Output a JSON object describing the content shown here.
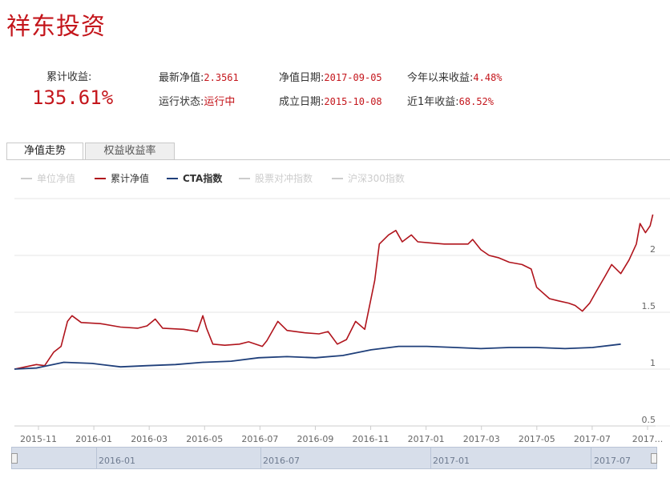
{
  "header": {
    "title": "祥东投资"
  },
  "stats": {
    "cumulative_label": "累计收益:",
    "cumulative_value": "135.61%",
    "latest_nav_label": "最新净值:",
    "latest_nav_value": "2.3561",
    "nav_date_label": "净值日期:",
    "nav_date_value": "2017-09-05",
    "ytd_label": "今年以来收益:",
    "ytd_value": "4.48%",
    "status_label": "运行状态:",
    "status_value": "运行中",
    "inception_label": "成立日期:",
    "inception_value": "2015-10-08",
    "one_year_label": "近1年收益:",
    "one_year_value": "68.52%"
  },
  "tabs": [
    "净值走势",
    "权益收益率"
  ],
  "legend": [
    {
      "label": "单位净值",
      "enabled": false
    },
    {
      "label": "累计净值",
      "enabled": true
    },
    {
      "label": "CTA指数",
      "enabled": true
    },
    {
      "label": "股票对冲指数",
      "enabled": false
    },
    {
      "label": "沪深300指数",
      "enabled": false
    }
  ],
  "navigator": {
    "labels": [
      "2016-01",
      "2016-07",
      "2017-01",
      "2017-07"
    ]
  },
  "colors": {
    "accent": "#c4161c",
    "nav_series": "#b0141c",
    "cta_series": "#1f3f7a",
    "disabled": "#cccccc"
  },
  "chart_data": {
    "type": "line",
    "x_ticks": [
      "2015-11",
      "2016-01",
      "2016-03",
      "2016-05",
      "2016-07",
      "2016-09",
      "2016-11",
      "2017-01",
      "2017-03",
      "2017-05",
      "2017-07",
      "2017..."
    ],
    "y_ticks": [
      0.5,
      1,
      1.5,
      2
    ],
    "ylim": [
      0.5,
      2.5
    ],
    "xlim": [
      "2015-10-08",
      "2017-09-08"
    ],
    "grid": true,
    "series": [
      {
        "name": "累计净值",
        "points": [
          [
            "2015-10-08",
            1.0
          ],
          [
            "2015-10-20",
            1.02
          ],
          [
            "2015-11-01",
            1.04
          ],
          [
            "2015-11-10",
            1.03
          ],
          [
            "2015-11-20",
            1.15
          ],
          [
            "2015-11-28",
            1.2
          ],
          [
            "2015-12-05",
            1.42
          ],
          [
            "2015-12-10",
            1.47
          ],
          [
            "2015-12-20",
            1.41
          ],
          [
            "2016-01-10",
            1.4
          ],
          [
            "2016-02-01",
            1.37
          ],
          [
            "2016-02-20",
            1.36
          ],
          [
            "2016-03-01",
            1.38
          ],
          [
            "2016-03-10",
            1.44
          ],
          [
            "2016-03-18",
            1.36
          ],
          [
            "2016-04-10",
            1.35
          ],
          [
            "2016-04-25",
            1.33
          ],
          [
            "2016-05-01",
            1.47
          ],
          [
            "2016-05-05",
            1.36
          ],
          [
            "2016-05-12",
            1.22
          ],
          [
            "2016-05-25",
            1.21
          ],
          [
            "2016-06-10",
            1.22
          ],
          [
            "2016-06-20",
            1.24
          ],
          [
            "2016-07-05",
            1.2
          ],
          [
            "2016-07-10",
            1.25
          ],
          [
            "2016-07-22",
            1.42
          ],
          [
            "2016-08-01",
            1.34
          ],
          [
            "2016-08-20",
            1.32
          ],
          [
            "2016-09-05",
            1.31
          ],
          [
            "2016-09-15",
            1.33
          ],
          [
            "2016-09-25",
            1.22
          ],
          [
            "2016-10-05",
            1.26
          ],
          [
            "2016-10-15",
            1.42
          ],
          [
            "2016-10-25",
            1.35
          ],
          [
            "2016-11-05",
            1.78
          ],
          [
            "2016-11-10",
            2.1
          ],
          [
            "2016-11-20",
            2.18
          ],
          [
            "2016-11-28",
            2.22
          ],
          [
            "2016-12-05",
            2.12
          ],
          [
            "2016-12-15",
            2.18
          ],
          [
            "2016-12-22",
            2.12
          ],
          [
            "2017-01-05",
            2.11
          ],
          [
            "2017-01-20",
            2.1
          ],
          [
            "2017-02-15",
            2.1
          ],
          [
            "2017-02-20",
            2.14
          ],
          [
            "2017-03-01",
            2.05
          ],
          [
            "2017-03-10",
            2.0
          ],
          [
            "2017-03-20",
            1.98
          ],
          [
            "2017-04-01",
            1.94
          ],
          [
            "2017-04-15",
            1.92
          ],
          [
            "2017-04-25",
            1.88
          ],
          [
            "2017-05-01",
            1.72
          ],
          [
            "2017-05-15",
            1.62
          ],
          [
            "2017-05-25",
            1.6
          ],
          [
            "2017-06-05",
            1.58
          ],
          [
            "2017-06-12",
            1.56
          ],
          [
            "2017-06-20",
            1.51
          ],
          [
            "2017-06-28",
            1.58
          ],
          [
            "2017-07-05",
            1.68
          ],
          [
            "2017-07-15",
            1.82
          ],
          [
            "2017-07-22",
            1.92
          ],
          [
            "2017-08-01",
            1.84
          ],
          [
            "2017-08-10",
            1.96
          ],
          [
            "2017-08-18",
            2.1
          ],
          [
            "2017-08-22",
            2.28
          ],
          [
            "2017-08-28",
            2.2
          ],
          [
            "2017-09-02",
            2.26
          ],
          [
            "2017-09-05",
            2.36
          ]
        ]
      },
      {
        "name": "CTA指数",
        "points": [
          [
            "2015-10-08",
            1.0
          ],
          [
            "2015-11-01",
            1.01
          ],
          [
            "2015-12-01",
            1.06
          ],
          [
            "2016-01-01",
            1.05
          ],
          [
            "2016-02-01",
            1.02
          ],
          [
            "2016-03-01",
            1.03
          ],
          [
            "2016-04-01",
            1.04
          ],
          [
            "2016-05-01",
            1.06
          ],
          [
            "2016-06-01",
            1.07
          ],
          [
            "2016-07-01",
            1.1
          ],
          [
            "2016-08-01",
            1.11
          ],
          [
            "2016-09-01",
            1.1
          ],
          [
            "2016-10-01",
            1.12
          ],
          [
            "2016-11-01",
            1.17
          ],
          [
            "2016-12-01",
            1.2
          ],
          [
            "2017-01-01",
            1.2
          ],
          [
            "2017-02-01",
            1.19
          ],
          [
            "2017-03-01",
            1.18
          ],
          [
            "2017-04-01",
            1.19
          ],
          [
            "2017-05-01",
            1.19
          ],
          [
            "2017-06-01",
            1.18
          ],
          [
            "2017-07-01",
            1.19
          ],
          [
            "2017-08-01",
            1.22
          ]
        ]
      }
    ]
  }
}
